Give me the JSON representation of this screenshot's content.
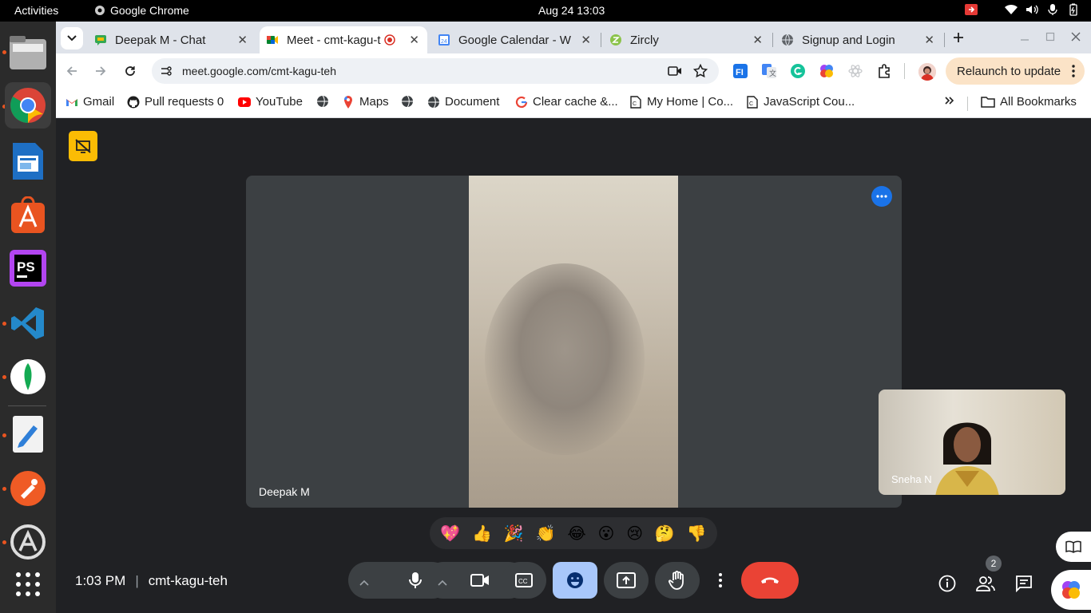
{
  "topbar": {
    "activities": "Activities",
    "app_name": "Google Chrome",
    "clock": "Aug 24  13:03"
  },
  "dock": {
    "items": [
      "files-icon",
      "chrome-icon",
      "writer-icon",
      "app-center-icon",
      "phpstorm-icon",
      "vscode-icon",
      "mongodb-compass-icon",
      "text-editor-icon",
      "postman-icon",
      "software-updater-icon",
      "show-apps-icon"
    ]
  },
  "tabs": [
    {
      "title": "Deepak M - Chat",
      "close": "✕"
    },
    {
      "title": "Meet - cmt-kagu-t",
      "close": "✕"
    },
    {
      "title": "Google Calendar - W",
      "close": "✕"
    },
    {
      "title": "Zircly",
      "close": "✕"
    },
    {
      "title": "Signup and Login",
      "close": "✕"
    }
  ],
  "toolbar": {
    "url": "meet.google.com/cmt-kagu-teh",
    "relaunch": "Relaunch to update"
  },
  "bookmarks": [
    {
      "label": "Gmail"
    },
    {
      "label": "Pull requests 0"
    },
    {
      "label": "YouTube"
    },
    {
      "label": "Maps"
    },
    {
      "label": "Document"
    },
    {
      "label": "Clear cache &..."
    },
    {
      "label": "My Home | Co..."
    },
    {
      "label": "JavaScript Cou..."
    }
  ],
  "all_bookmarks": "All Bookmarks",
  "meet": {
    "main_participant": "Deepak M",
    "pip_participant": "Sneha N",
    "reactions": [
      "💖",
      "👍",
      "🎉",
      "👏",
      "😂",
      "😮",
      "😢",
      "🤔",
      "👎"
    ],
    "time": "1:03 PM",
    "separator": "|",
    "meeting_code": "cmt-kagu-teh",
    "participant_count": "2"
  },
  "colors": {
    "end_call": "#ea4335",
    "accent_blue": "#1a73e8",
    "active_ctrl": "#a8c7fa",
    "warning": "#fbbc04"
  }
}
